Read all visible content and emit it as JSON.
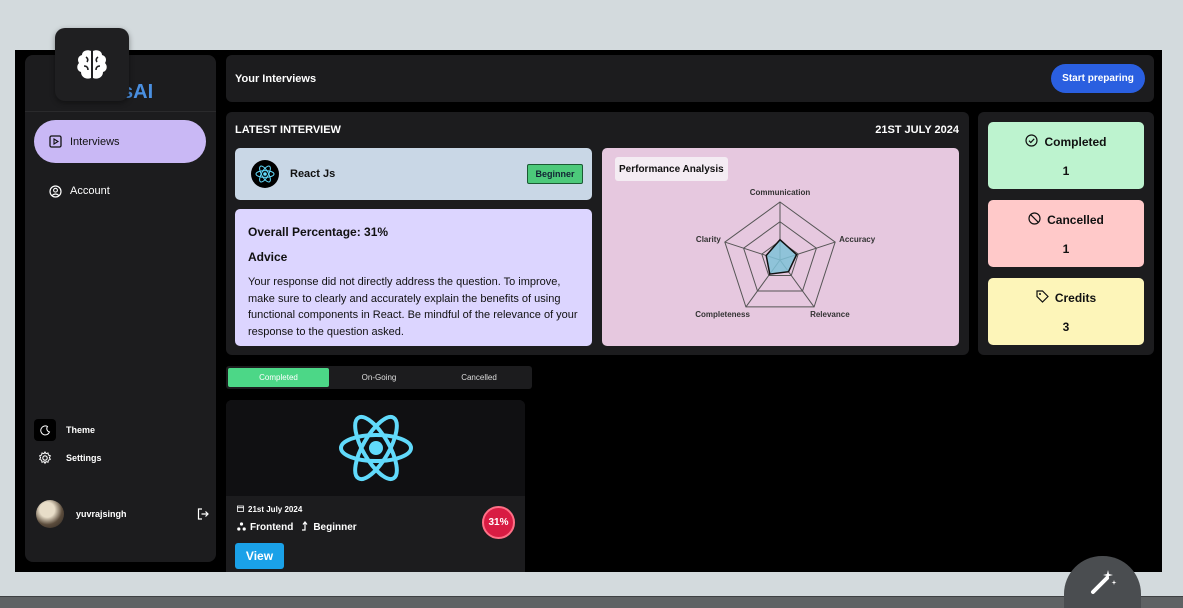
{
  "sidebar": {
    "brand": "sAI",
    "items": [
      {
        "label": "Interviews",
        "icon": "play-square-icon"
      },
      {
        "label": "Account",
        "icon": "user-circle-icon"
      }
    ],
    "theme_label": "Theme",
    "settings_label": "Settings",
    "username": "yuvrajsingh"
  },
  "header": {
    "title": "Your Interviews",
    "start_button": "Start preparing"
  },
  "latest": {
    "title": "LATEST INTERVIEW",
    "date": "21ST JULY 2024",
    "topic": "React Js",
    "level": "Beginner",
    "overall": "Overall Percentage: 31%",
    "advice_heading": "Advice",
    "advice_text": "Your response did not directly address the question. To improve, make sure to clearly and accurately explain the benefits of using functional components in React. Be mindful of the relevance of your response to the question asked.",
    "performance_title": "Performance Analysis",
    "radar_axes": [
      "Communication",
      "Accuracy",
      "Relevance",
      "Completeness",
      "Clarity"
    ],
    "radar_values": [
      0.35,
      0.3,
      0.25,
      0.3,
      0.25
    ]
  },
  "stats": {
    "completed_label": "Completed",
    "completed_value": "1",
    "cancelled_label": "Cancelled",
    "cancelled_value": "1",
    "credits_label": "Credits",
    "credits_value": "3"
  },
  "tabs": [
    "Completed",
    "On-Going",
    "Cancelled"
  ],
  "card": {
    "date": "21st July 2024",
    "category": "Frontend",
    "level": "Beginner",
    "score": "31%",
    "view_button": "View"
  },
  "colors": {
    "accent": "#2a5fe0",
    "active_nav": "#c9b8f5",
    "completed_tab": "#4cd787",
    "score": "#d81c43"
  }
}
